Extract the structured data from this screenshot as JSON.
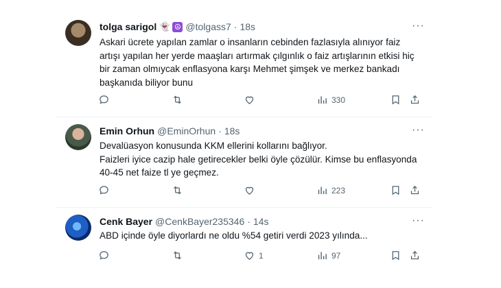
{
  "tweets": [
    {
      "name": "tolga sarigol",
      "handle": "@tolgass7",
      "time": "18s",
      "body": "Askari ücrete yapılan zamlar o insanların cebinden fazlasıyla alınıyor faiz artışı yapılan her yerde maaşları artırmak çılgınlık  o faiz artışlarının etkisi hiç bir zaman olmıycak enflasyona karşı Mehmet şimşek ve merkez bankadı başkanıda biliyor bunu",
      "views": "330",
      "likes": ""
    },
    {
      "name": "Emin Orhun",
      "handle": "@EminOrhun",
      "time": "18s",
      "body": "Devalüasyon konusunda KKM ellerini kollarını bağlıyor.\nFaizleri iyice cazip hale getirecekler belki öyle çözülür. Kimse bu enflasyonda 40-45 net faize tl ye geçmez.",
      "views": "223",
      "likes": ""
    },
    {
      "name": "Cenk Bayer",
      "handle": "@CenkBayer235346",
      "time": "14s",
      "body": "ABD içinde öyle diyorlardı ne oldu %54 getiri verdi 2023 yılında...",
      "views": "97",
      "likes": "1"
    }
  ],
  "separator": "·",
  "more_label": "···",
  "colors": {
    "text": "#0f1419",
    "secondary": "#536471",
    "divider": "#eff3f4"
  },
  "icons": [
    "reply-icon",
    "retweet-icon",
    "like-icon",
    "views-icon",
    "bookmark-icon",
    "share-icon"
  ]
}
